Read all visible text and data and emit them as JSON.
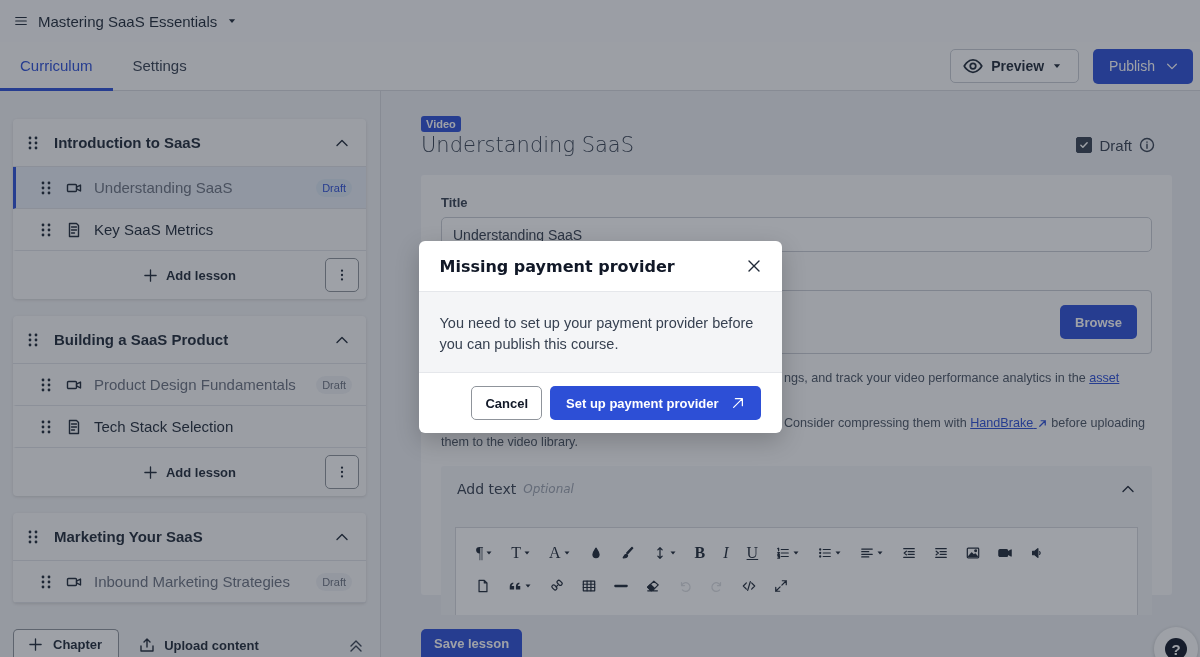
{
  "course": {
    "title": "Mastering SaaS Essentials"
  },
  "tabs": [
    {
      "label": "Curriculum",
      "selected": true
    },
    {
      "label": "Settings",
      "selected": false
    }
  ],
  "preview_button": "Preview",
  "publish_button": "Publish",
  "chapters": [
    {
      "title": "Introduction to SaaS",
      "expanded": true,
      "add_lesson": "Add lesson",
      "lessons": [
        {
          "title": "Understanding SaaS",
          "kind": "video",
          "badge": "Draft",
          "selected": true
        },
        {
          "title": "Key SaaS Metrics",
          "kind": "text",
          "selected": false
        }
      ]
    },
    {
      "title": "Building a SaaS Product",
      "expanded": true,
      "add_lesson": "Add lesson",
      "lessons": [
        {
          "title": "Product Design Fundamentals",
          "kind": "video",
          "badge": "Draft",
          "selected": false
        },
        {
          "title": "Tech Stack Selection",
          "kind": "text",
          "selected": false
        }
      ]
    },
    {
      "title": "Marketing Your SaaS",
      "expanded": true,
      "lessons": [
        {
          "title": "Inbound Marketing Strategies",
          "kind": "video",
          "badge": "Draft",
          "selected": false
        }
      ]
    }
  ],
  "sidebar_footer": {
    "chapter_button": "Chapter",
    "upload_button": "Upload content"
  },
  "lesson": {
    "type_badge": "Video",
    "title": "Understanding SaaS",
    "draft": {
      "label": "Draft",
      "checked": true
    },
    "title_label": "Title",
    "title_value": "Understanding SaaS",
    "browse_button": "Browse",
    "note_1": {
      "text": "ngs, and track your video performance analytics in the ",
      "link": "asset"
    },
    "note_2": {
      "before": "Consider compressing them with ",
      "link": "HandBrake",
      "after": " before uploading them to the video library."
    },
    "text_section": {
      "title": "Add text",
      "hint": "Optional",
      "expanded": true
    },
    "save_button": "Save lesson",
    "help_button": "?"
  },
  "toolbar": [
    [
      {
        "kind": "paragraph",
        "text": "¶",
        "caret": true,
        "disabled": false
      },
      {
        "kind": "fontsize",
        "text": "T",
        "caret": true,
        "disabled": false
      },
      {
        "kind": "font",
        "text": "A",
        "caret": true,
        "disabled": false
      },
      {
        "kind": "color",
        "caret": false,
        "disabled": false
      },
      {
        "kind": "highlight",
        "caret": false,
        "disabled": false
      },
      {
        "kind": "lineheight",
        "caret": true,
        "disabled": false
      },
      {
        "kind": "bold",
        "text": "B",
        "caret": false,
        "disabled": false
      },
      {
        "kind": "italic",
        "text": "I",
        "caret": false,
        "disabled": false
      },
      {
        "kind": "underline",
        "text": "U",
        "caret": false,
        "disabled": false
      },
      {
        "kind": "ordered",
        "caret": true,
        "disabled": false
      },
      {
        "kind": "bullets",
        "caret": true,
        "disabled": false
      },
      {
        "kind": "align",
        "caret": true,
        "disabled": false
      },
      {
        "kind": "outdent",
        "caret": false,
        "disabled": false
      },
      {
        "kind": "indent",
        "caret": false,
        "disabled": false
      },
      {
        "kind": "image",
        "caret": false,
        "disabled": false
      },
      {
        "kind": "video",
        "caret": false,
        "disabled": false
      },
      {
        "kind": "audio",
        "caret": false,
        "disabled": false
      }
    ],
    [
      {
        "kind": "file",
        "caret": false,
        "disabled": false
      },
      {
        "kind": "quote",
        "caret": true,
        "disabled": false
      },
      {
        "kind": "link",
        "caret": false,
        "disabled": false
      },
      {
        "kind": "table",
        "caret": false,
        "disabled": false
      },
      {
        "kind": "rule",
        "caret": false,
        "disabled": false
      },
      {
        "kind": "eraser",
        "caret": false,
        "disabled": false
      },
      {
        "kind": "undo",
        "caret": false,
        "disabled": true
      },
      {
        "kind": "redo",
        "caret": false,
        "disabled": true
      },
      {
        "kind": "code",
        "caret": false,
        "disabled": false
      },
      {
        "kind": "fullscreen",
        "caret": false,
        "disabled": false
      }
    ]
  ],
  "dialog": {
    "title": "Missing payment provider",
    "message": "You need to set up your payment provider before you can publish this course.",
    "cancel_button": "Cancel",
    "confirm_button": "Set up payment provider"
  }
}
